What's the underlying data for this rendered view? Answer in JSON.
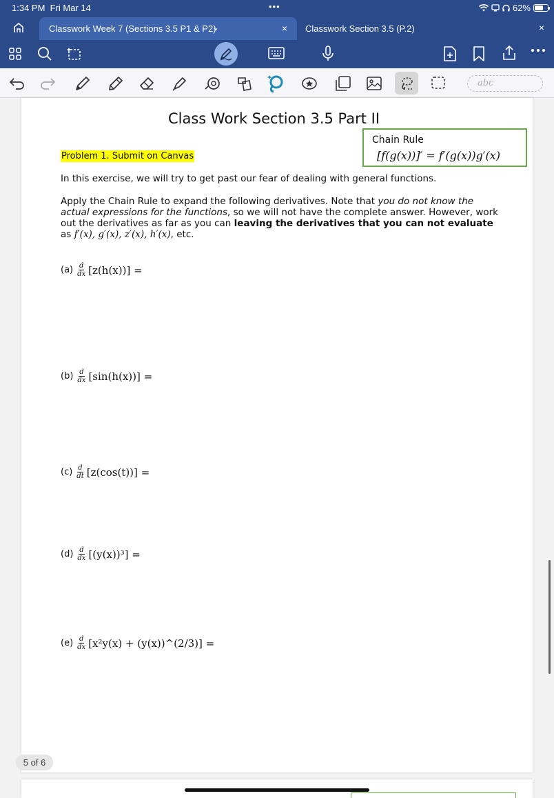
{
  "status": {
    "time": "1:34 PM",
    "date": "Fri Mar 14",
    "battery": "62%",
    "dots": "•••"
  },
  "tabs": {
    "active_label": "Classwork Week 7 (Sections 3.5 P1 & P2)",
    "chevron": "⌄",
    "close": "×",
    "second_label": "Classwork Section 3.5 (P.2)"
  },
  "toolbar": {
    "text_box_placeholder": "abc"
  },
  "colors": {
    "chrome_blue": "#2a4a8a",
    "active_tab": "#3e64ae",
    "highlight": "#ffff00",
    "box_green": "#6aa84f"
  },
  "document": {
    "title": "Class Work Section 3.5 Part II",
    "chain_rule_title": "Chain Rule",
    "chain_rule_formula": "[f(g(x))]′ = f′(g(x))g′(x)",
    "problem": "Problem 1. Submit on Canvas",
    "intro": "In this exercise, we will try to get past our fear of dealing with general functions.",
    "instructions": {
      "part1": "Apply the Chain Rule to expand the following derivatives. Note that ",
      "em1": "you do not know the actual expressions for the functions",
      "part2": ", so we will not have the complete answer. However, work out the derivatives as far as you can ",
      "bold1": "leaving the derivatives that you can not evaluate",
      "part3": " as ",
      "math": "f′(x), g′(x), z′(x), h′(x)",
      "part4": ", etc."
    },
    "items": [
      {
        "label": "(a)",
        "num": "d",
        "den": "dx",
        "expr": "[z(h(x))] ="
      },
      {
        "label": "(b)",
        "num": "d",
        "den": "dx",
        "expr": "[sin(h(x))] ="
      },
      {
        "label": "(c)",
        "num": "d",
        "den": "dt",
        "expr": "[z(cos(t))] ="
      },
      {
        "label": "(d)",
        "num": "d",
        "den": "dx",
        "expr": "[(y(x))³] ="
      },
      {
        "label": "(e)",
        "num": "d",
        "den": "dx",
        "expr": "[x²y(x) + (y(x))^(2/3)] ="
      }
    ]
  },
  "page_indicator": "5 of 6"
}
